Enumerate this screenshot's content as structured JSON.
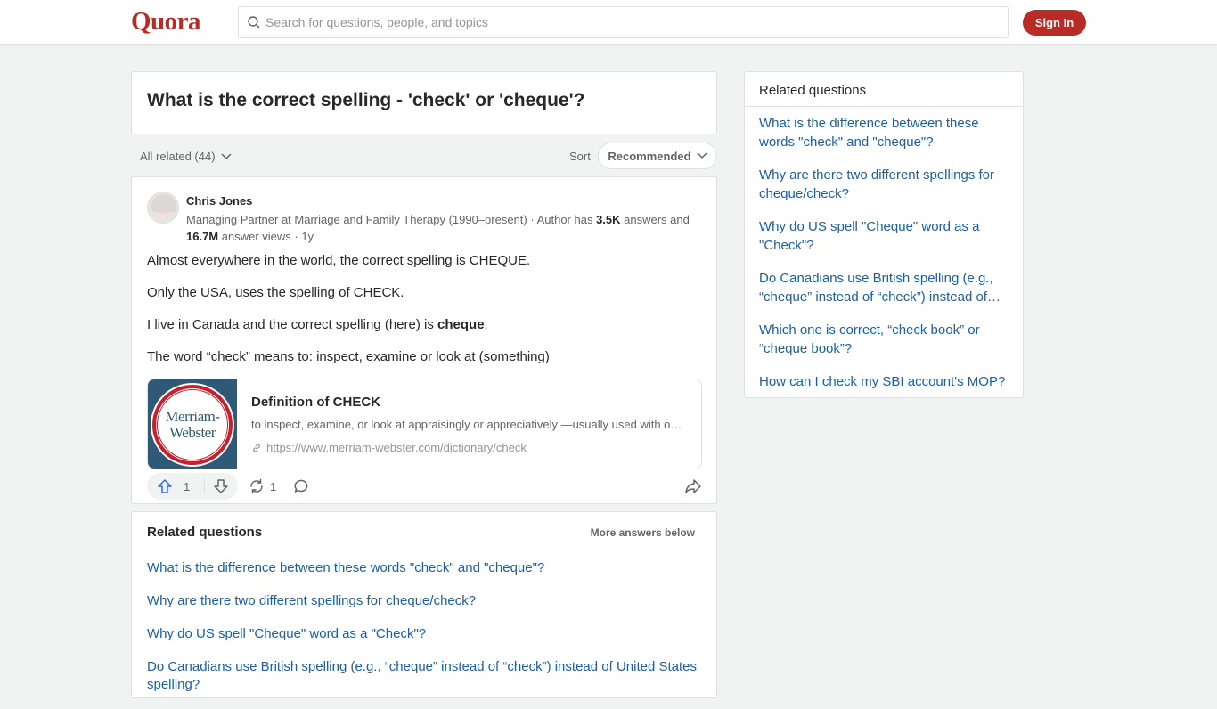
{
  "header": {
    "logo": "Quora",
    "search_placeholder": "Search for questions, people, and topics",
    "signin_label": "Sign In",
    "brand_color": "#b92b27"
  },
  "question": {
    "title": "What is the correct spelling - 'check' or 'cheque'?"
  },
  "filters": {
    "all_related": "All related (44)",
    "sort_label": "Sort",
    "sort_value": "Recommended"
  },
  "answer": {
    "author_name": "Chris Jones",
    "credential_prefix": "Managing Partner at Marriage and Family Therapy (1990–present) · Author has ",
    "answers_count": "3.5K",
    "credential_mid": " answers and ",
    "answer_views": "16.7M",
    "credential_suffix": " answer views · 1y",
    "paragraphs": [
      "Almost everywhere in the world, the correct spelling is CHEQUE.",
      "Only the USA, uses the spelling of CHECK.",
      "The word “check” means to: inspect, examine or look at (something)"
    ],
    "canada_prefix": "I live in Canada and the correct spelling (here) is ",
    "canada_bold": "cheque",
    "canada_suffix": ".",
    "link_preview": {
      "logo_line1": "Merriam-",
      "logo_line2": "Webster",
      "title": "Definition of CHECK",
      "description": "to inspect, examine, or look at appraisingly or appreciatively —usually used with out; to investigate and ascertain the condition of",
      "url": "https://www.merriam-webster.com/dictionary/check"
    },
    "upvotes": "1",
    "shares": "1"
  },
  "related_questions_main": {
    "title": "Related questions",
    "more_label": "More answers below",
    "items": [
      "What is the difference between these words \"check\" and \"cheque\"?",
      "Why are there two different spellings for cheque/check?",
      "Why do US spell \"Cheque\" word as a \"Check\"?",
      "Do Canadians use British spelling (e.g., “cheque” instead of “check”) instead of United States spelling?"
    ]
  },
  "related_questions_side": {
    "title": "Related questions",
    "items": [
      "What is the difference between these words \"check\" and \"cheque\"?",
      "Why are there two different spellings for cheque/check?",
      "Why do US spell \"Cheque\" word as a \"Check\"?",
      "Do Canadians use British spelling (e.g., “cheque” instead of “check”) instead of…",
      "Which one is correct, “check book” or “cheque book”?",
      "How can I check my SBI account's MOP?"
    ]
  }
}
